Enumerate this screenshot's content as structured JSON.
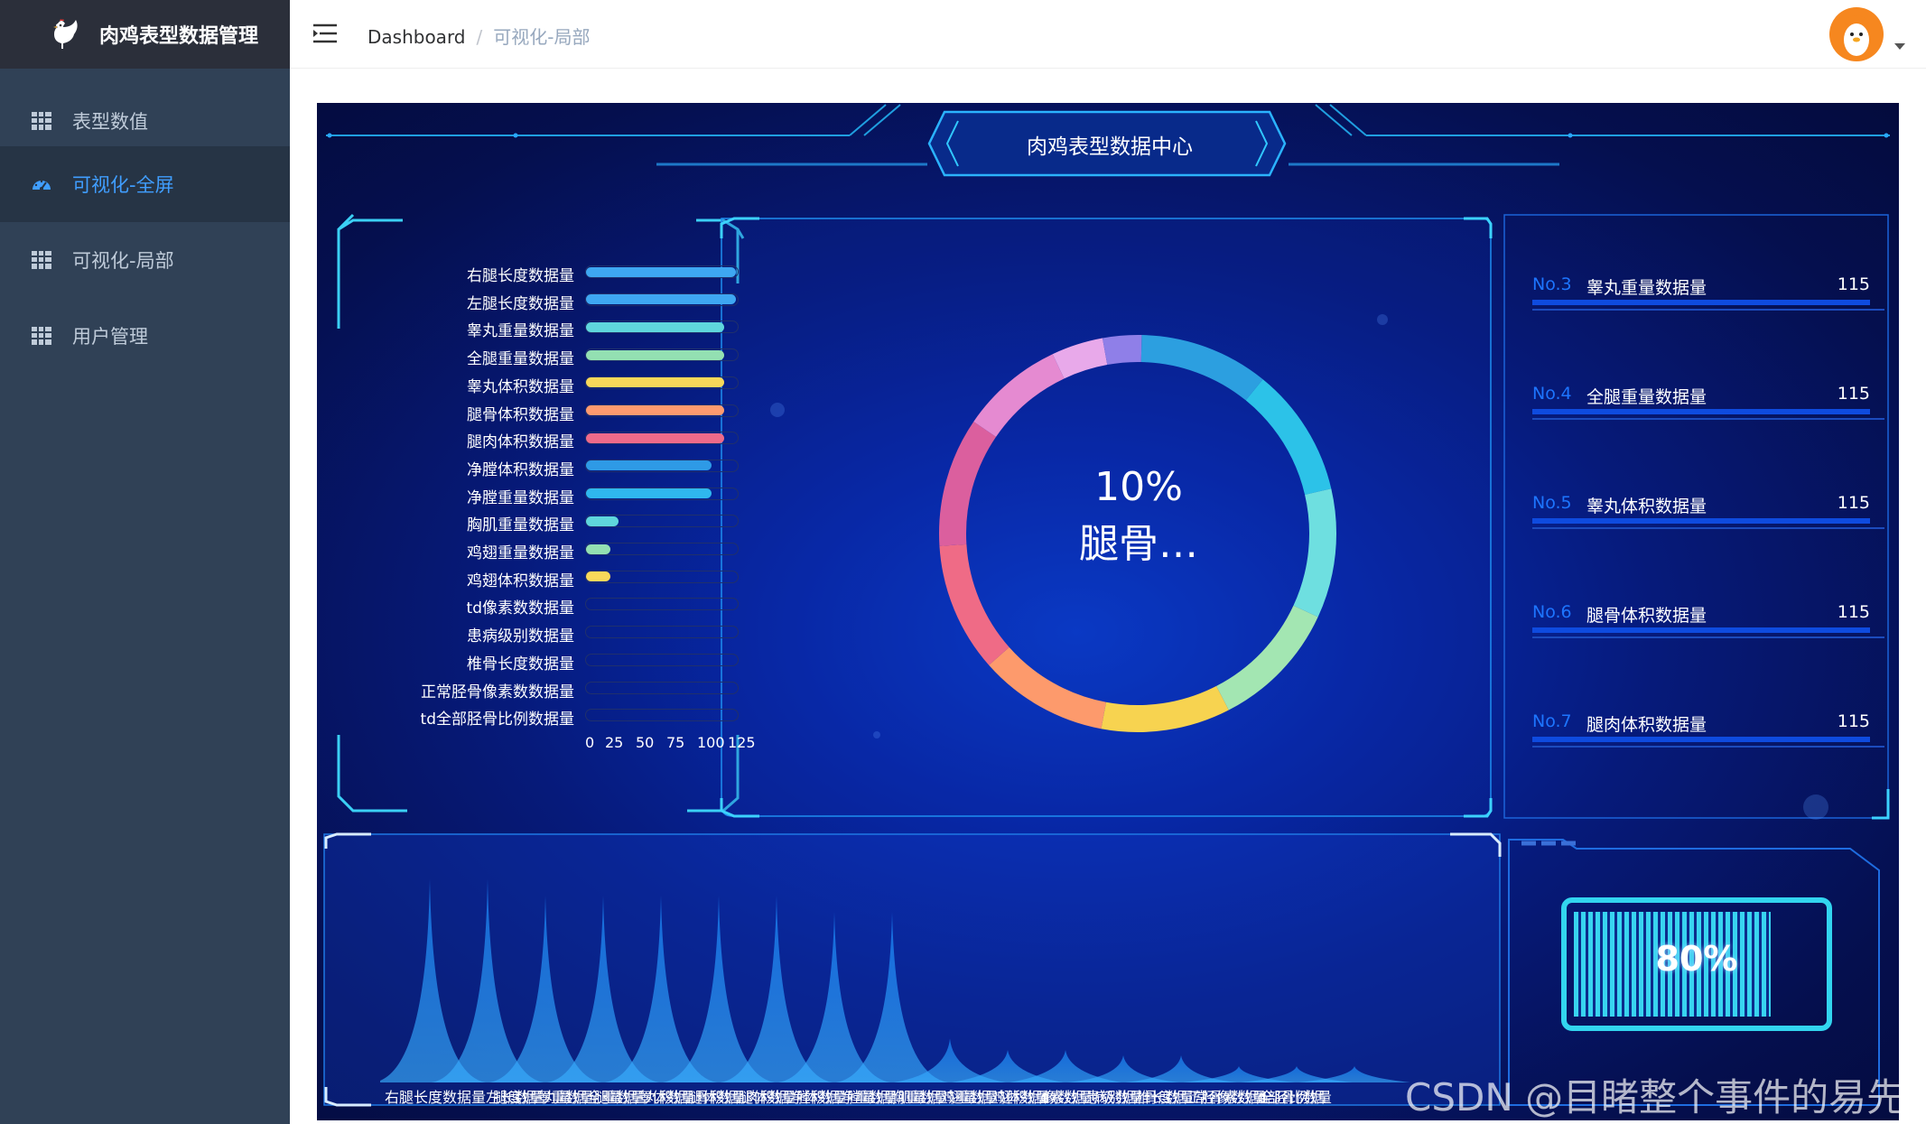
{
  "app": {
    "title": "肉鸡表型数据管理"
  },
  "sidebar": {
    "items": [
      {
        "label": "表型数值",
        "active": false
      },
      {
        "label": "可视化-全屏",
        "active": true
      },
      {
        "label": "可视化-局部",
        "active": false
      },
      {
        "label": "用户管理",
        "active": false
      }
    ]
  },
  "header": {
    "breadcrumb": [
      "Dashboard",
      "可视化-局部"
    ],
    "separator": "/"
  },
  "dashboard": {
    "title": "肉鸡表型数据中心",
    "center_percent": "10%",
    "center_label": "腿骨…",
    "battery_percent": "80%",
    "battery_value": 0.8,
    "ranking": [
      {
        "no": "No.3",
        "name": "睾丸重量数据量",
        "value": "115"
      },
      {
        "no": "No.4",
        "name": "全腿重量数据量",
        "value": "115"
      },
      {
        "no": "No.5",
        "name": "睾丸体积数据量",
        "value": "115"
      },
      {
        "no": "No.6",
        "name": "腿骨体积数据量",
        "value": "115"
      },
      {
        "no": "No.7",
        "name": "腿肉体积数据量",
        "value": "115"
      }
    ],
    "bottom_axis_label": "右腿长度数据量",
    "bottom_axis_overlap_text": "左腿长度数据量睾丸重量数据量全腿重量数据量睾丸体积数据量腿骨体积数据量腿肉体积数据量净膛体积数据量净膛重量数据量胸肌重量数据量鸡翅重量数据量鸡翅体积数据量td像素数数据量患病级别数据量椎骨长度数据量正常胫骨像素数数据量td全部胫骨比例数据量"
  },
  "chart_data": [
    {
      "type": "bar",
      "orientation": "horizontal",
      "categories": [
        "右腿长度数据量",
        "左腿长度数据量",
        "睾丸重量数据量",
        "全腿重量数据量",
        "睾丸体积数据量",
        "腿骨体积数据量",
        "腿肉体积数据量",
        "净膛体积数据量",
        "净膛重量数据量",
        "胸肌重量数据量",
        "鸡翅重量数据量",
        "鸡翅体积数据量",
        "td像素数数据量",
        "患病级别数据量",
        "椎骨长度数据量",
        "正常胫骨像素数数据量",
        "td全部胫骨比例数据量"
      ],
      "values": [
        125,
        125,
        115,
        115,
        115,
        115,
        115,
        105,
        105,
        27,
        20,
        20,
        0,
        0,
        0,
        0,
        0
      ],
      "colors": [
        "#3ea7f2",
        "#3ea7f2",
        "#5fd6dc",
        "#93e0b2",
        "#f8d85a",
        "#fe9a6f",
        "#ee6a8a",
        "#2e9ae6",
        "#2fb7ee",
        "#5fd6dc",
        "#93e0b2",
        "#f8d85a",
        "#3ea7f2",
        "#3ea7f2",
        "#3ea7f2",
        "#3ea7f2",
        "#3ea7f2"
      ],
      "xticks": [
        "0",
        "25",
        "50",
        "75",
        "100",
        "125"
      ],
      "xlim": [
        0,
        125
      ]
    },
    {
      "type": "pie",
      "variant": "donut",
      "slice_colors": [
        "#2c9fe0",
        "#2cc2e8",
        "#6edfe0",
        "#a3e6b2",
        "#f7d350",
        "#fd9a6c",
        "#ef6b86",
        "#db5f9e",
        "#e58ad1",
        "#e8a9ea",
        "#8f7fe8"
      ],
      "values": [
        10,
        10,
        10,
        10,
        10,
        10,
        10,
        10,
        8,
        4,
        3
      ]
    },
    {
      "type": "area",
      "variant": "pictorial-spikes",
      "values": [
        125,
        125,
        115,
        115,
        115,
        115,
        115,
        105,
        105,
        27,
        20,
        20,
        0,
        0,
        0,
        0,
        0
      ],
      "ylim": [
        0,
        125
      ]
    }
  ],
  "watermark": "CSDN @目睹整个事件的易先生",
  "colors": {
    "sidebar": "#304156",
    "active": "#409eff",
    "screen": "#061a7a",
    "accent": "#31c8ff"
  }
}
